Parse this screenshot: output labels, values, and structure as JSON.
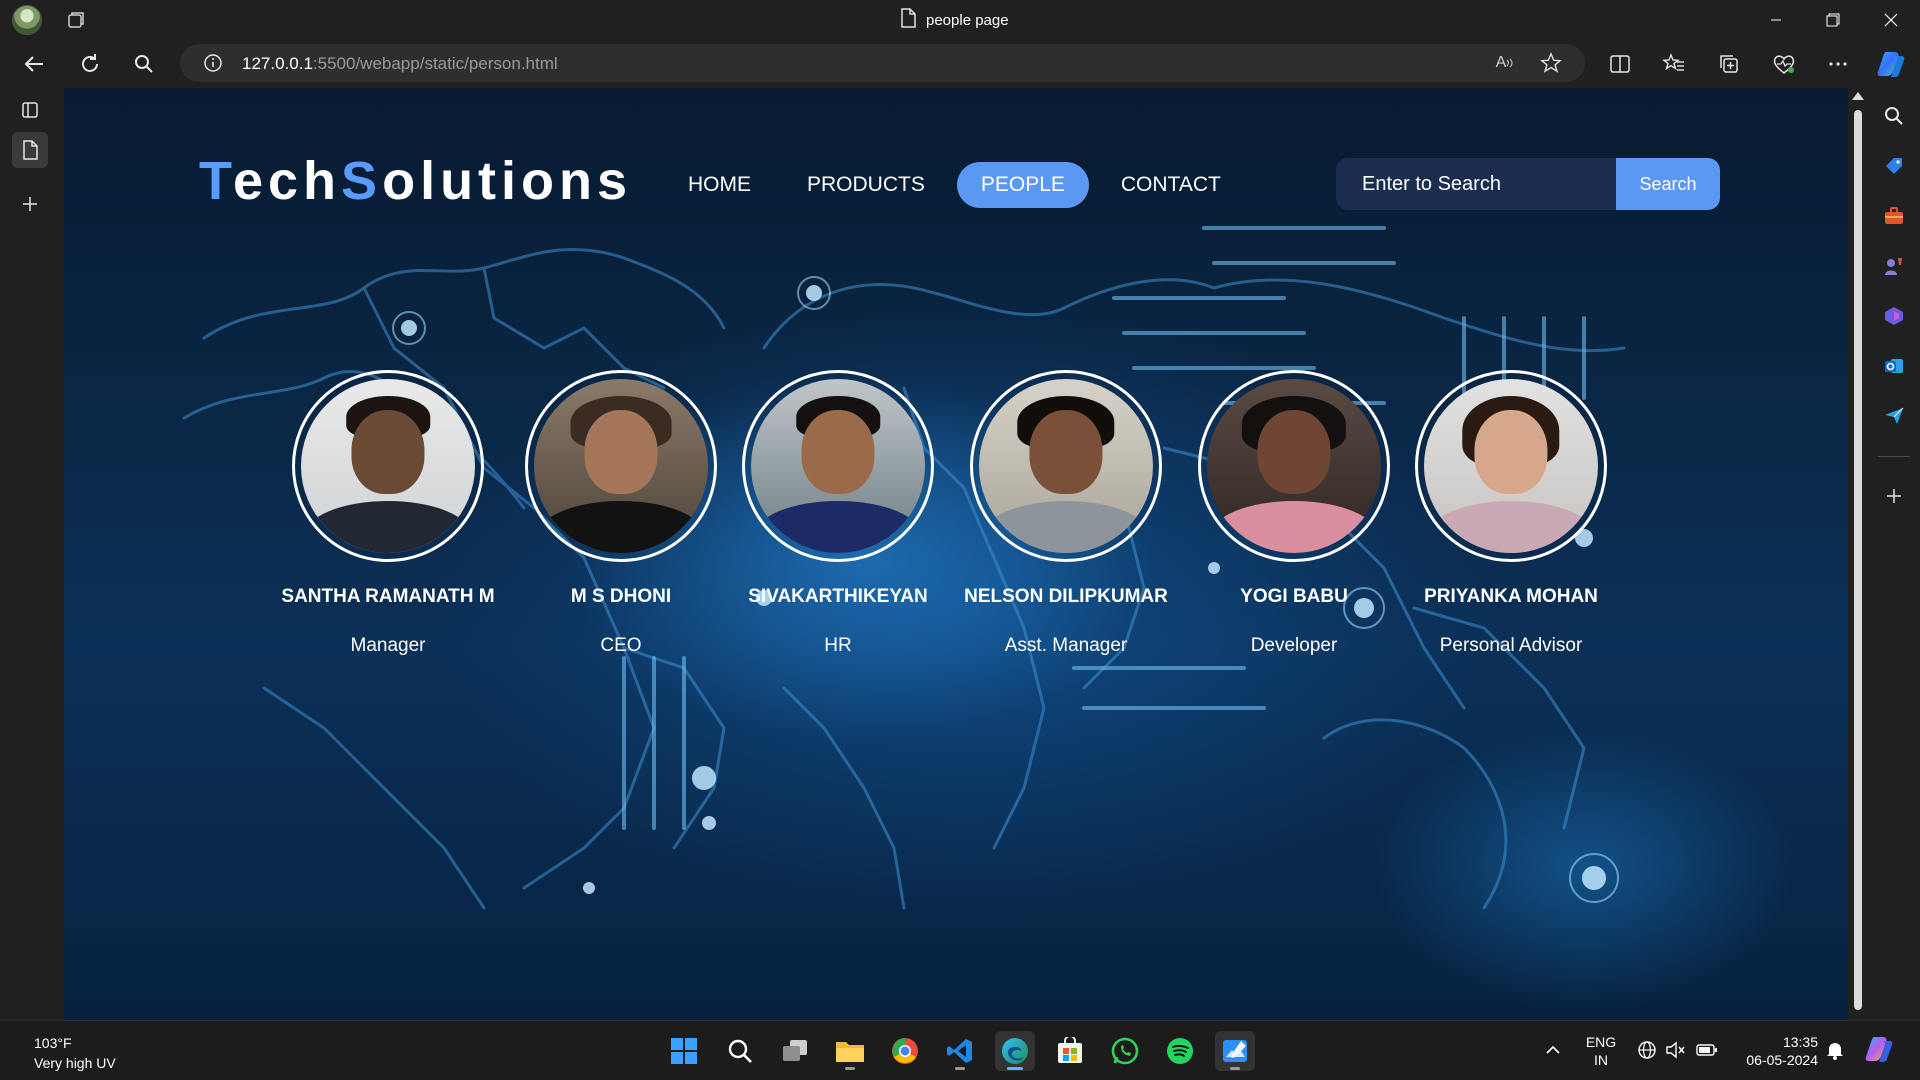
{
  "browser": {
    "tab_title": "people page",
    "url_host": "127.0.0.1",
    "url_rest": ":5500/webapp/static/person.html",
    "read_aloud_label": "A"
  },
  "site": {
    "logo_first_initial": "T",
    "logo_first_rest": "ech",
    "logo_second_initial": "S",
    "logo_second_rest": "olutions",
    "nav": [
      {
        "label": "HOME"
      },
      {
        "label": "PRODUCTS"
      },
      {
        "label": "PEOPLE"
      },
      {
        "label": "CONTACT"
      }
    ],
    "search_placeholder": "Enter to Search",
    "search_button": "Search"
  },
  "people": [
    {
      "name": "SANTHA RAMANATH M",
      "role": "Manager"
    },
    {
      "name": "M S DHONI",
      "role": "CEO"
    },
    {
      "name": "SIVAKARTHIKEYAN",
      "role": "HR"
    },
    {
      "name": "NELSON DILIPKUMAR",
      "role": "Asst. Manager"
    },
    {
      "name": "YOGI BABU",
      "role": "Developer"
    },
    {
      "name": "PRIYANKA MOHAN",
      "role": "Personal Advisor"
    }
  ],
  "taskbar": {
    "weather_temp": "103°F",
    "weather_desc": "Very high UV",
    "lang_line1": "ENG",
    "lang_line2": "IN",
    "time": "13:35",
    "date": "06-05-2024"
  },
  "colors": {
    "accent": "#5b98f4",
    "logo_accent": "#5a9bff",
    "page_bg": "#0a2746"
  }
}
